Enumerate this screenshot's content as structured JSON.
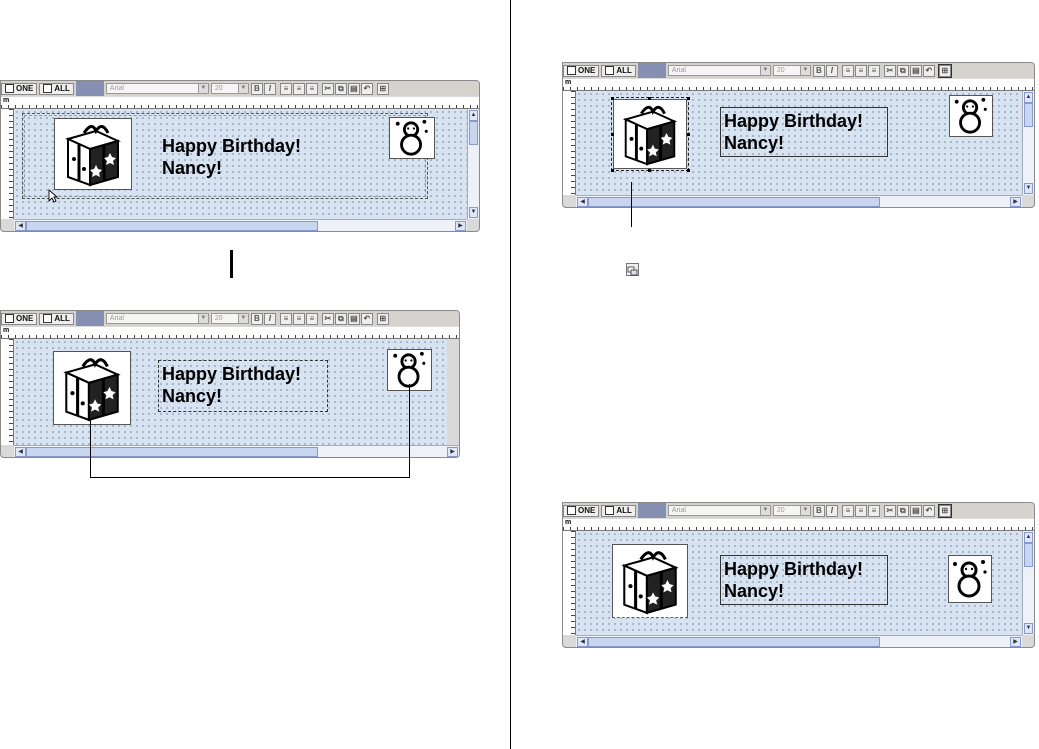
{
  "toolbar": {
    "mode_one": "ONE",
    "mode_all": "ALL",
    "font_name": "Arial",
    "font_size": "20",
    "bold_label": "B",
    "italic_label": "I",
    "ruler_unit": "m"
  },
  "label": {
    "line1": "Happy Birthday!",
    "line2": "Nancy!"
  },
  "icons": {
    "gift": "gift-box-image",
    "snowman": "snowman-image",
    "arrange": "arrange-objects-icon",
    "cursor": "mouse-pointer-icon"
  },
  "colors": {
    "canvas": "#d7e3f1",
    "toolbar_band": "#8690b2"
  }
}
